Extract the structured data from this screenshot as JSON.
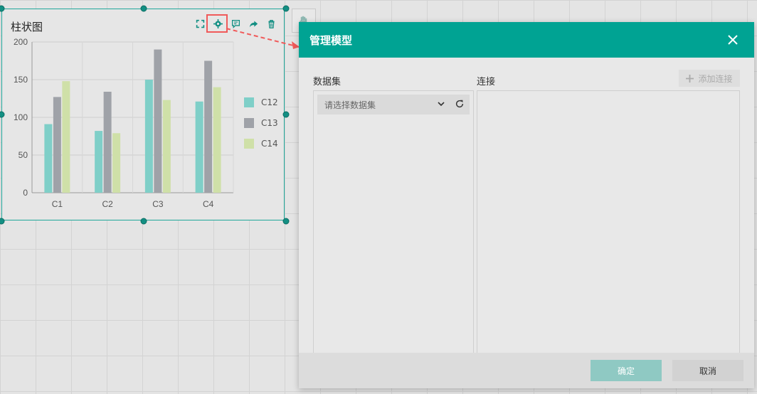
{
  "widget": {
    "title": "柱状图",
    "toolbar": {
      "fullscreen_icon": "expand-icon",
      "settings_icon": "gear-icon",
      "comment_icon": "comment-icon",
      "share_icon": "share-arrow-icon",
      "delete_icon": "trash-icon"
    }
  },
  "chart_data": {
    "type": "bar",
    "categories": [
      "C1",
      "C2",
      "C3",
      "C4"
    ],
    "series": [
      {
        "name": "C12",
        "color": "#7fcfc8",
        "values": [
          91,
          82,
          150,
          121
        ]
      },
      {
        "name": "C13",
        "color": "#9fa2a8",
        "values": [
          127,
          134,
          190,
          175
        ]
      },
      {
        "name": "C14",
        "color": "#cfe0a8",
        "values": [
          148,
          79,
          123,
          140
        ]
      }
    ],
    "ylim": [
      0,
      200
    ],
    "yticks": [
      0,
      50,
      100,
      150,
      200
    ],
    "legend": "right",
    "grid": true
  },
  "dialog": {
    "title": "管理模型",
    "close_icon": "close-icon",
    "dataset_label": "数据集",
    "dataset_placeholder": "请选择数据集",
    "connect_label": "连接",
    "add_connect_label": "添加连接",
    "ok_label": "确定",
    "cancel_label": "取消"
  },
  "colors": {
    "accent": "#00a393",
    "highlight": "#f05a5a"
  }
}
